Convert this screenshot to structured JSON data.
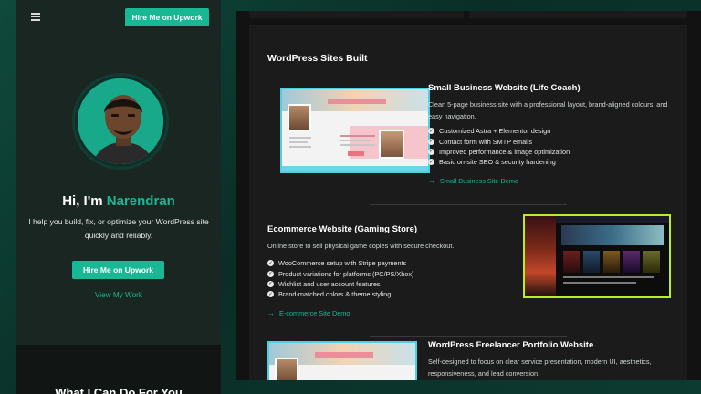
{
  "mobile": {
    "top_hire_label": "Hire Me on Upwork",
    "greeting_prefix": "Hi, I'm ",
    "name": "Narendran",
    "intro": "I help you build, fix, or optimize your WordPress site quickly and reliably.",
    "hire_label": "Hire Me on Upwork",
    "view_work_label": "View My Work",
    "services_heading": "What I Can Do For You"
  },
  "desktop": {
    "section_title": "WordPress Sites Built",
    "projects": [
      {
        "title": "Small Business Website (Life Coach)",
        "description": "Clean 5-page business site with a professional layout, brand-aligned colours, and easy navigation.",
        "features": [
          "Customized Astra + Elementor design",
          "Contact form with SMTP emails",
          "Improved performance & image optimization",
          "Basic on-site SEO & security hardening"
        ],
        "demo_label": "Small Business Site Demo"
      },
      {
        "title": "Ecommerce Website (Gaming Store)",
        "description": "Online store to sell physical game copies with secure checkout.",
        "features": [
          "WooCommerce setup with Stripe payments",
          "Product variations for platforms (PC/PS/Xbox)",
          "Wishlist and user account features",
          "Brand-matched colors & theme styling"
        ],
        "demo_label": "E-commerce Site Demo"
      },
      {
        "title": "WordPress Freelancer Portfolio Website",
        "description": "Self-designed to focus on clear service presentation, modern UI, aesthetics, responsiveness, and lead conversion."
      }
    ]
  },
  "icons": {
    "menu": "hamburger-icon",
    "check": "check-circle-icon",
    "arrow": "arrow-right-icon"
  },
  "colors": {
    "accent": "#18b894",
    "panel_dark": "#1b1b1b",
    "mobile_bg": "#1a2622"
  }
}
